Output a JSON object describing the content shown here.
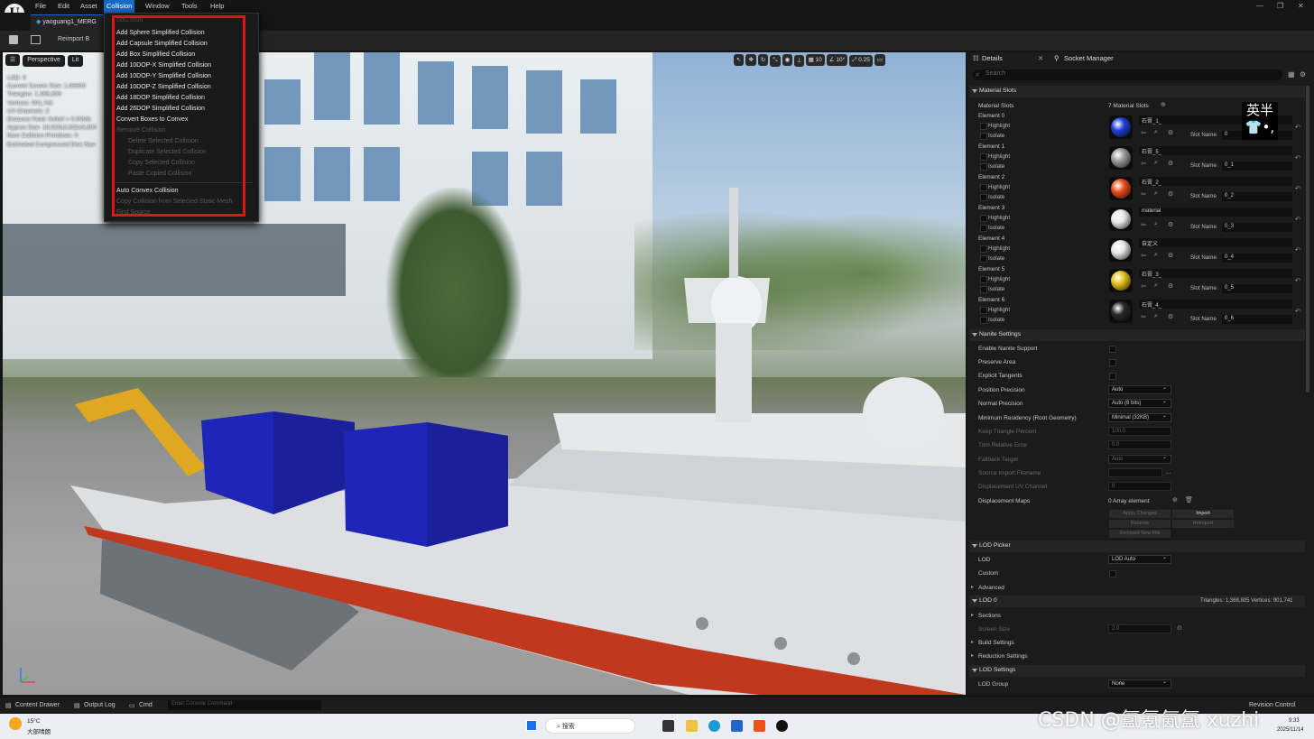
{
  "menubar": {
    "items": [
      "File",
      "Edit",
      "Asset",
      "Collision",
      "Window",
      "Tools",
      "Help"
    ]
  },
  "tab": {
    "title": "yaoguang1_MERG"
  },
  "toolbar": {
    "reimport": "Reimport B"
  },
  "viewport": {
    "mode": "Perspective",
    "lit": "Lit",
    "info": [
      "LOD: 0",
      "Current Screen Size: 1.86509",
      "Triangles: 1,368,805",
      "Vertices: 901,741",
      "UV Channels: 2",
      "Distance Field: 0x0x0 = 0.00Mb",
      "Approx Size: 16,915x2,832x5,800",
      "Num Collision Primitives: 0",
      "Estimated Compressed Disk Size"
    ],
    "toolbar_right": [
      "10",
      "10°",
      "0.25"
    ]
  },
  "collision_menu": {
    "header": "COLLISION",
    "items": [
      {
        "label": "Add Sphere Simplified Collision",
        "enabled": true
      },
      {
        "label": "Add Capsule Simplified Collision",
        "enabled": true
      },
      {
        "label": "Add Box Simplified Collision",
        "enabled": true
      },
      {
        "label": "Add 10DOP-X Simplified Collision",
        "enabled": true
      },
      {
        "label": "Add 10DOP-Y Simplified Collision",
        "enabled": true
      },
      {
        "label": "Add 10DOP-Z Simplified Collision",
        "enabled": true
      },
      {
        "label": "Add 18DOP Simplified Collision",
        "enabled": true
      },
      {
        "label": "Add 26DOP Simplified Collision",
        "enabled": true
      },
      {
        "label": "Convert Boxes to Convex",
        "enabled": true
      },
      {
        "label": "Remove Collision",
        "enabled": false
      },
      {
        "label": "Delete Selected Collision",
        "enabled": false
      },
      {
        "label": "Duplicate Selected Collision",
        "enabled": false
      },
      {
        "label": "Copy Selected Collision",
        "enabled": false
      },
      {
        "label": "Paste Copied Collision",
        "enabled": false
      },
      {
        "label": "Auto Convex Collision",
        "enabled": true
      },
      {
        "label": "Copy Collision from Selected Static Mesh",
        "enabled": false
      },
      {
        "label": "Find Source",
        "enabled": false
      }
    ]
  },
  "details": {
    "tabs": [
      "Details",
      "Socket Manager"
    ],
    "search_placeholder": "Search",
    "material_slots": {
      "section": "Material Slots",
      "label": "Material Slots",
      "count": "7 Material Slots",
      "highlight": "Highlight",
      "isolate": "Isolate",
      "slot_name_label": "Slot Name",
      "elements": [
        {
          "name": "Element 0",
          "material": "石膏_1_",
          "slot": "0",
          "color": "#1f3fd8"
        },
        {
          "name": "Element 1",
          "material": "石膏_5_",
          "slot": "0_1",
          "color": "#9a9a9a"
        },
        {
          "name": "Element 2",
          "material": "石膏_2_",
          "slot": "0_2",
          "color": "#e84d1c"
        },
        {
          "name": "Element 3",
          "material": "material",
          "slot": "0_3",
          "color": "#e8e8e8"
        },
        {
          "name": "Element 4",
          "material": "自定义",
          "slot": "0_4",
          "color": "#e6e6e6"
        },
        {
          "name": "Element 5",
          "material": "石膏_3_",
          "slot": "0_5",
          "color": "#e6c21a"
        },
        {
          "name": "Element 6",
          "material": "石膏_4_",
          "slot": "0_6",
          "color": "#2a2a2a"
        }
      ]
    },
    "nanite": {
      "section": "Nanite Settings",
      "enable": "Enable Nanite Support",
      "preserve_area": "Preserve Area",
      "explicit_tangents": "Explicit Tangents",
      "position_precision": "Position Precision",
      "position_precision_val": "Auto",
      "normal_precision": "Normal Precision",
      "normal_precision_val": "Auto (8 bits)",
      "min_residency": "Minimum Residency (Root Geometry)",
      "min_residency_val": "Minimal (32KB)",
      "keep_triangle": "Keep Triangle Percent",
      "keep_triangle_val": "100.0",
      "trim_error": "Trim Relative Error",
      "trim_error_val": "0.0",
      "fallback_target": "Fallback Target",
      "fallback_target_val": "Auto",
      "source_import": "Source Import Filename",
      "displacement_uv": "Displacement UV Channel",
      "displacement_uv_val": "0",
      "displacement_maps": "Displacement Maps",
      "displacement_maps_val": "0 Array element",
      "apply": "Apply Changes",
      "import": "Import",
      "remove": "Remove",
      "reimport": "Reimport",
      "reimport_new": "Reimport New File"
    },
    "lod_picker": {
      "section": "LOD Picker",
      "lod": "LOD",
      "lod_val": "LOD Auto",
      "custom": "Custom",
      "advanced": "Advanced"
    },
    "lod0": {
      "section": "LOD 0",
      "stats": "Triangles: 1,368,805   Vertices: 901,741",
      "sections": "Sections",
      "screen_size": "Screen Size",
      "screen_size_val": "2.0",
      "build_settings": "Build Settings",
      "reduction_settings": "Reduction Settings"
    },
    "lod_settings": {
      "section": "LOD Settings",
      "lod_group": "LOD Group",
      "lod_group_val": "None"
    }
  },
  "bottombar": {
    "content_drawer": "Content Drawer",
    "output_log": "Output Log",
    "cmd": "Cmd",
    "console_placeholder": "Enter Console Command",
    "revision_control": "Revision Control"
  },
  "taskbar": {
    "weather_temp": "15°C",
    "weather_desc": "大部晴朗",
    "search": "搜索",
    "time": "9:33",
    "date": "2025/11/14"
  },
  "watermark": "CSDN @氲氪氤氲 xuzhi",
  "ime": {
    "line1": "英半",
    "line2": "👕•,"
  }
}
